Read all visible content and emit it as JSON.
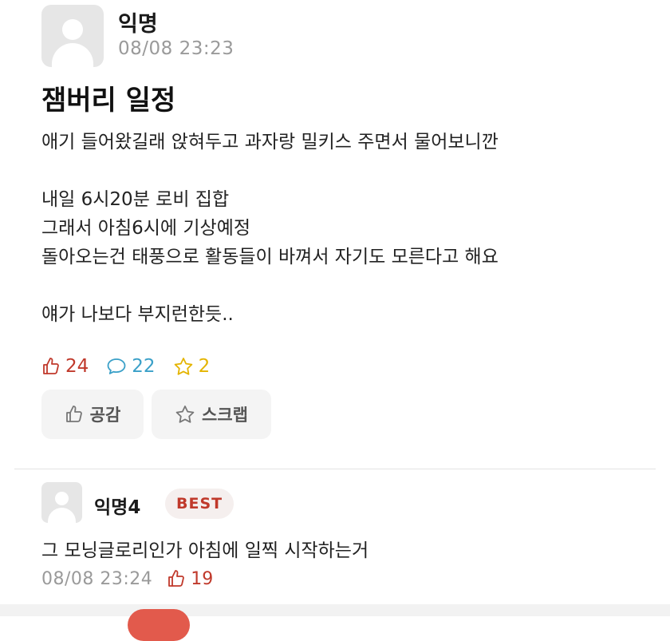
{
  "post": {
    "author": "익명",
    "date": "08/08 23:23",
    "title": "잼버리 일정",
    "body_lines": [
      "애기 들어왔길래 앉혀두고 과자랑 밀키스 주면서 물어보니깐",
      "",
      "내일 6시20분 로비 집합",
      "그래서 아침6시에 기상예정",
      "돌아오는건 태풍으로 활동들이 바껴서 자기도 모른다고 해요",
      "",
      "얘가 나보다 부지런한듯.."
    ],
    "stats": {
      "likes": "24",
      "comments": "22",
      "scraps": "2"
    },
    "buttons": {
      "like_label": "공감",
      "scrap_label": "스크랩"
    }
  },
  "comment": {
    "author": "익명4",
    "badge": "BEST",
    "text": "그 모닝글로리인가 아침에 일찍 시작하는거",
    "date": "08/08 23:24",
    "likes": "19"
  },
  "colors": {
    "like": "#c0392b",
    "comment": "#3aa0c8",
    "star": "#e4b400",
    "muted": "#9a9a9a",
    "button_bg": "#f4f4f4"
  },
  "icons": {
    "like": "thumbs-up-icon",
    "comment": "speech-bubble-icon",
    "scrap": "star-icon",
    "avatar": "default-avatar-icon"
  }
}
